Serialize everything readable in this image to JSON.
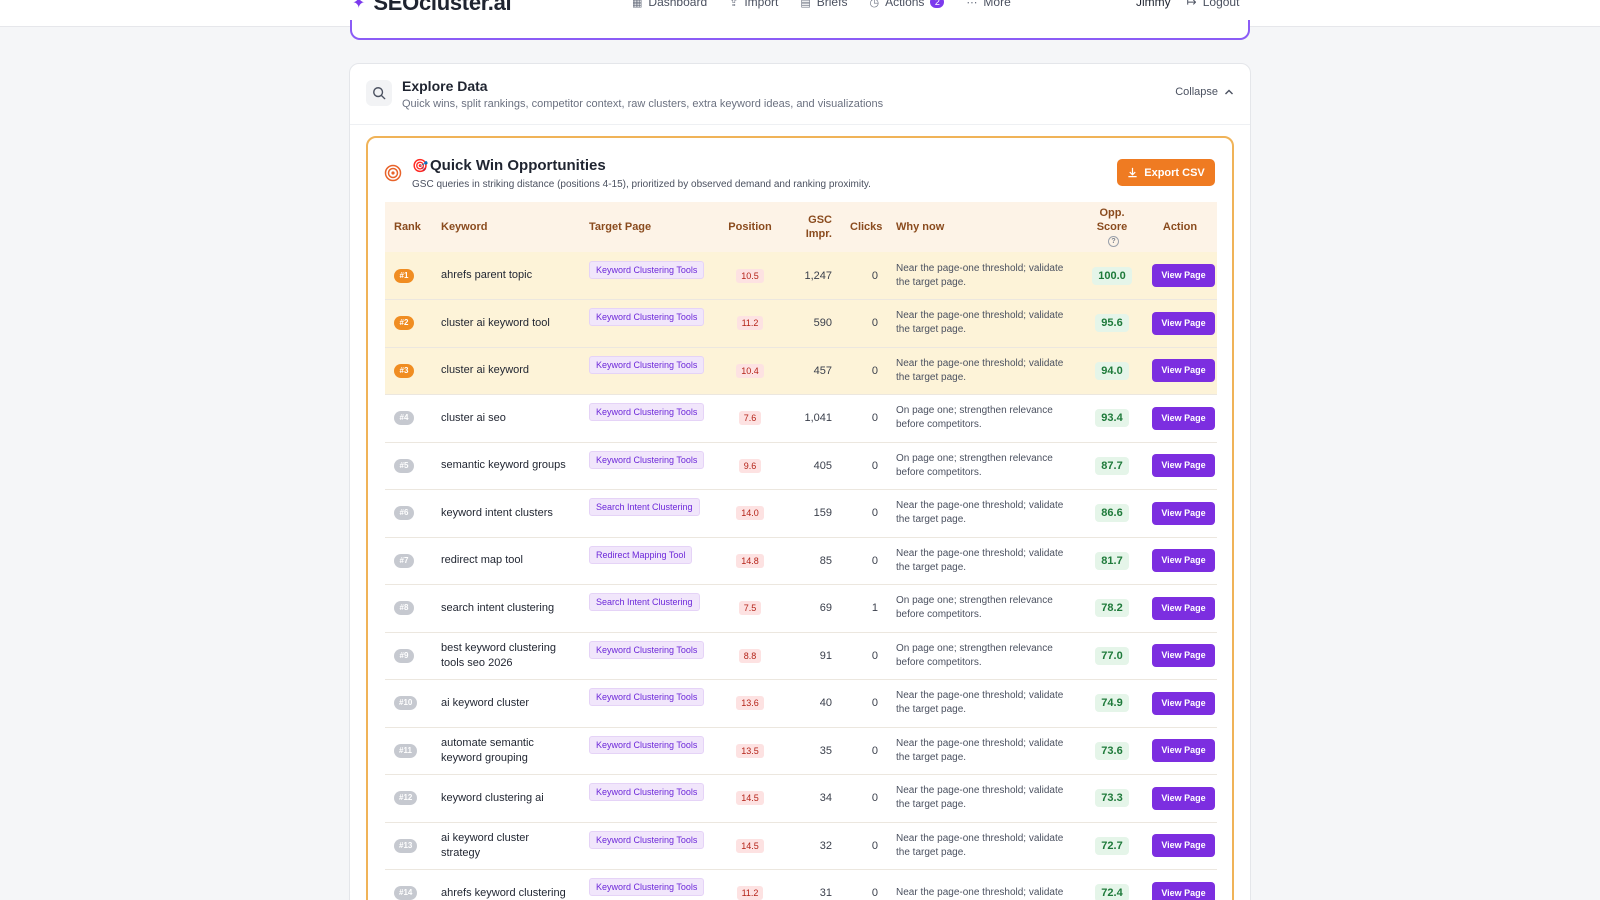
{
  "header": {
    "brand": "SEOcluster.ai",
    "nav": [
      {
        "label": "Dashboard",
        "icon": "grid-icon"
      },
      {
        "label": "Import",
        "icon": "upload-icon"
      },
      {
        "label": "Briefs",
        "icon": "document-icon"
      },
      {
        "label": "Actions",
        "icon": "check-circle-icon",
        "badge": "2"
      },
      {
        "label": "More",
        "icon": "dots-icon"
      }
    ],
    "user": "Jimmy",
    "logout": "Logout"
  },
  "explore": {
    "title": "Explore Data",
    "subtitle": "Quick wins, split rankings, competitor context, raw clusters, extra keyword ideas, and visualizations",
    "collapse": "Collapse"
  },
  "quick_win": {
    "title": "Quick Win Opportunities",
    "subtitle": "GSC queries in striking distance (positions 4-15), prioritized by observed demand and ranking proximity.",
    "export_label": "Export CSV",
    "columns": {
      "rank": "Rank",
      "keyword": "Keyword",
      "target_page": "Target Page",
      "position": "Position",
      "impr_line1": "GSC",
      "impr_line2": "Impr.",
      "clicks": "Clicks",
      "why": "Why now",
      "score_line1": "Opp.",
      "score_line2": "Score",
      "action": "Action"
    },
    "view_label": "View Page",
    "rows": [
      {
        "rank": "#1",
        "keyword": "ahrefs parent topic",
        "page": "Keyword Clustering Tools",
        "position": "10.5",
        "impr": "1,247",
        "clicks": "0",
        "why": "Near the page-one threshold; validate the target page.",
        "score": "100.0",
        "top": true
      },
      {
        "rank": "#2",
        "keyword": "cluster ai keyword tool",
        "page": "Keyword Clustering Tools",
        "position": "11.2",
        "impr": "590",
        "clicks": "0",
        "why": "Near the page-one threshold; validate the target page.",
        "score": "95.6",
        "top": true
      },
      {
        "rank": "#3",
        "keyword": "cluster ai keyword",
        "page": "Keyword Clustering Tools",
        "position": "10.4",
        "impr": "457",
        "clicks": "0",
        "why": "Near the page-one threshold; validate the target page.",
        "score": "94.0",
        "top": true
      },
      {
        "rank": "#4",
        "keyword": "cluster ai seo",
        "page": "Keyword Clustering Tools",
        "position": "7.6",
        "impr": "1,041",
        "clicks": "0",
        "why": "On page one; strengthen relevance before competitors.",
        "score": "93.4",
        "top": false
      },
      {
        "rank": "#5",
        "keyword": "semantic keyword groups",
        "page": "Keyword Clustering Tools",
        "position": "9.6",
        "impr": "405",
        "clicks": "0",
        "why": "On page one; strengthen relevance before competitors.",
        "score": "87.7",
        "top": false
      },
      {
        "rank": "#6",
        "keyword": "keyword intent clusters",
        "page": "Search Intent Clustering",
        "position": "14.0",
        "impr": "159",
        "clicks": "0",
        "why": "Near the page-one threshold; validate the target page.",
        "score": "86.6",
        "top": false
      },
      {
        "rank": "#7",
        "keyword": "redirect map tool",
        "page": "Redirect Mapping Tool",
        "position": "14.8",
        "impr": "85",
        "clicks": "0",
        "why": "Near the page-one threshold; validate the target page.",
        "score": "81.7",
        "top": false
      },
      {
        "rank": "#8",
        "keyword": "search intent clustering",
        "page": "Search Intent Clustering",
        "position": "7.5",
        "impr": "69",
        "clicks": "1",
        "why": "On page one; strengthen relevance before competitors.",
        "score": "78.2",
        "top": false
      },
      {
        "rank": "#9",
        "keyword": "best keyword clustering tools seo 2026",
        "page": "Keyword Clustering Tools",
        "position": "8.8",
        "impr": "91",
        "clicks": "0",
        "why": "On page one; strengthen relevance before competitors.",
        "score": "77.0",
        "top": false
      },
      {
        "rank": "#10",
        "keyword": "ai keyword cluster",
        "page": "Keyword Clustering Tools",
        "position": "13.6",
        "impr": "40",
        "clicks": "0",
        "why": "Near the page-one threshold; validate the target page.",
        "score": "74.9",
        "top": false
      },
      {
        "rank": "#11",
        "keyword": "automate semantic keyword grouping",
        "page": "Keyword Clustering Tools",
        "position": "13.5",
        "impr": "35",
        "clicks": "0",
        "why": "Near the page-one threshold; validate the target page.",
        "score": "73.6",
        "top": false
      },
      {
        "rank": "#12",
        "keyword": "keyword clustering ai",
        "page": "Keyword Clustering Tools",
        "position": "14.5",
        "impr": "34",
        "clicks": "0",
        "why": "Near the page-one threshold; validate the target page.",
        "score": "73.3",
        "top": false
      },
      {
        "rank": "#13",
        "keyword": "ai keyword cluster strategy",
        "page": "Keyword Clustering Tools",
        "position": "14.5",
        "impr": "32",
        "clicks": "0",
        "why": "Near the page-one threshold; validate the target page.",
        "score": "72.7",
        "top": false
      },
      {
        "rank": "#14",
        "keyword": "ahrefs keyword clustering",
        "page": "Keyword Clustering Tools",
        "position": "11.2",
        "impr": "31",
        "clicks": "0",
        "why": "Near the page-one threshold; validate",
        "score": "72.4",
        "top": false
      }
    ]
  }
}
